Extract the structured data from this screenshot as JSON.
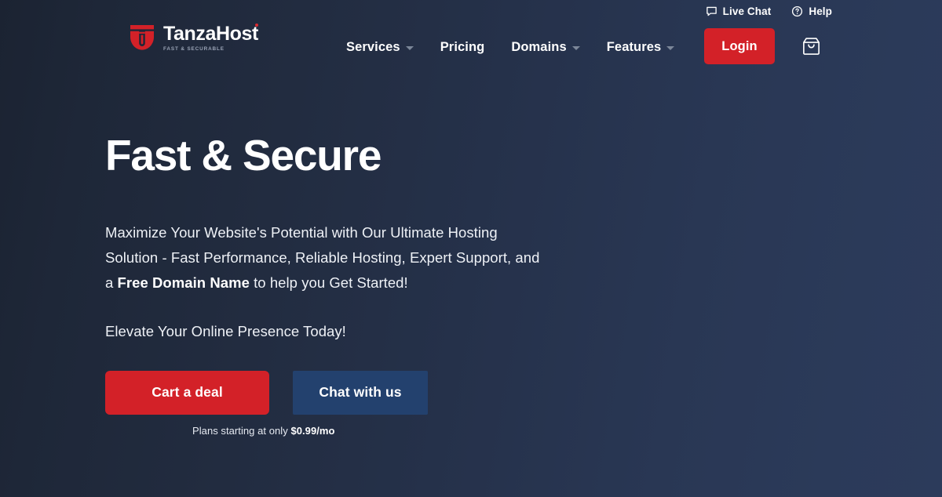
{
  "colors": {
    "background_dark": "#1b2332",
    "background_light": "#2c3b5b",
    "accent_red": "#d32128",
    "secondary_blue": "#23416e",
    "muted_text": "#9aa4b6"
  },
  "utility_bar": {
    "links": [
      {
        "label": "Live Chat",
        "icon": "chat-bubble-icon"
      },
      {
        "label": "Help",
        "icon": "question-circle-icon"
      }
    ]
  },
  "brand": {
    "name": "TanzaHost",
    "tagline": "FAST & SECURABLE",
    "mark": "shield-t-logo-icon"
  },
  "nav": {
    "items": [
      {
        "label": "Services",
        "has_dropdown": true
      },
      {
        "label": "Pricing",
        "has_dropdown": false
      },
      {
        "label": "Domains",
        "has_dropdown": true
      },
      {
        "label": "Features",
        "has_dropdown": true
      }
    ]
  },
  "header_actions": {
    "login_label": "Login",
    "cart_icon": "shopping-bag-icon"
  },
  "hero": {
    "title": "Fast & Secure",
    "description_part1": "Maximize Your Website's Potential with Our Ultimate Hosting Solution - Fast Performance, Reliable Hosting, Expert Support, and a ",
    "description_highlight": "Free Domain Name",
    "description_part2": " to help you Get Started!",
    "subtitle": "Elevate Your Online Presence Today!",
    "primary_cta": "Cart a deal",
    "secondary_cta": "Chat with us",
    "price_note_prefix": "Plans starting at only ",
    "price_note_value": "$0.99/mo"
  }
}
